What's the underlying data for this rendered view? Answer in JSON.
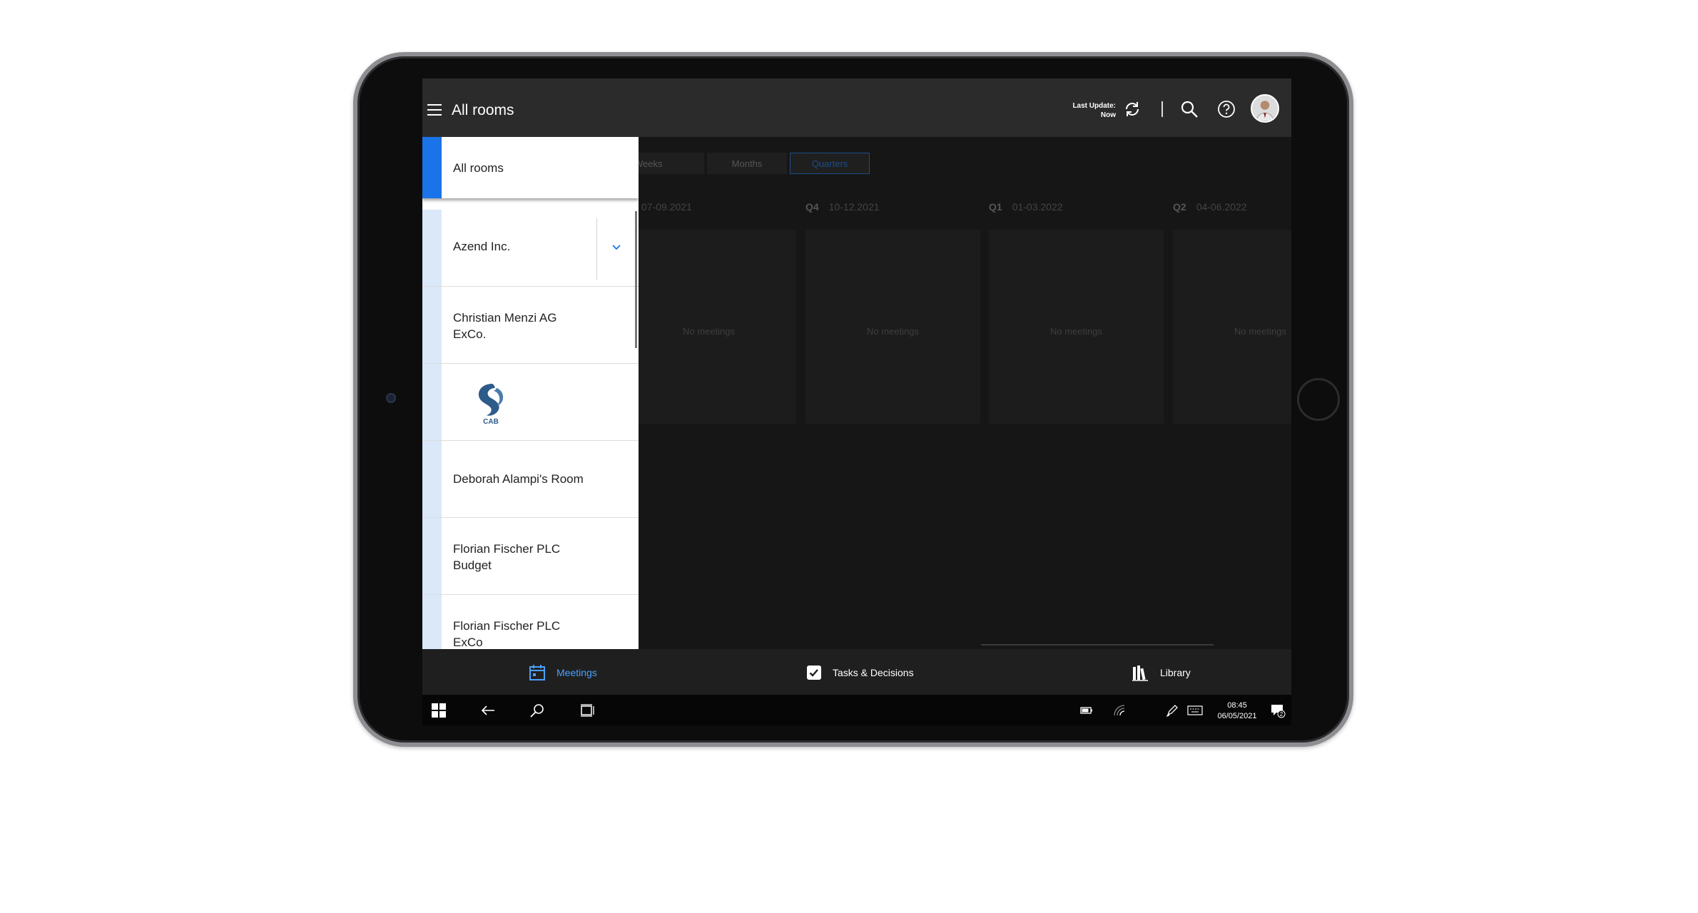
{
  "header": {
    "title": "All rooms",
    "last_update_label": "Last Update:",
    "last_update_value": "Now"
  },
  "view_tabs": [
    {
      "label": "Weeks"
    },
    {
      "label": "Months"
    },
    {
      "label": "Quarters",
      "active": true
    }
  ],
  "quarters": [
    {
      "q": "",
      "range": "07-09.2021",
      "empty": "No meetings"
    },
    {
      "q": "Q4",
      "range": "10-12.2021",
      "empty": "No meetings"
    },
    {
      "q": "Q1",
      "range": "01-03.2022",
      "empty": "No meetings"
    },
    {
      "q": "Q2",
      "range": "04-06.2022",
      "empty": "No meetings"
    }
  ],
  "panel": {
    "selected": "All rooms",
    "rooms": [
      {
        "line1": "Azend Inc.",
        "line2": ""
      },
      {
        "line1": "Christian Menzi AG",
        "line2": "ExCo."
      },
      {
        "logo_text": "CAB"
      },
      {
        "line1": "Deborah Alampi's Room",
        "line2": ""
      },
      {
        "line1": "Florian Fischer PLC",
        "line2": "Budget"
      },
      {
        "line1": "Florian Fischer PLC",
        "line2": "ExCo"
      }
    ]
  },
  "bottom_nav": {
    "meetings": "Meetings",
    "tasks": "Tasks & Decisions",
    "library": "Library"
  },
  "taskbar": {
    "time": "08:45",
    "date": "06/05/2021",
    "notification_count": "2"
  },
  "colors": {
    "accent": "#1a73e8",
    "active_nav": "#4aa0ff",
    "header_bg": "#2b2b2b"
  }
}
